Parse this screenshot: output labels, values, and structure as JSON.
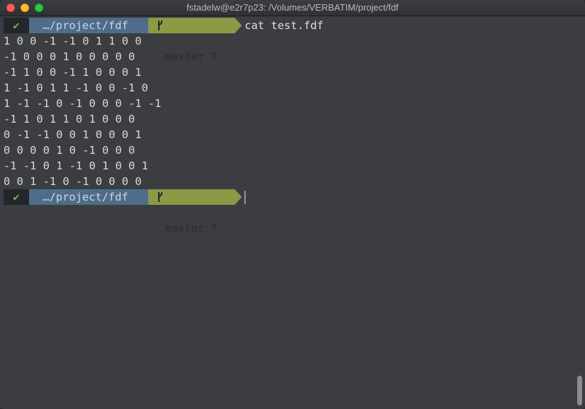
{
  "window": {
    "title": "fstadelw@e2r7p23: /Volumes/VERBATIM/project/fdf"
  },
  "colors": {
    "terminal_bg": "#3b3d41",
    "status_bg": "#23262a",
    "status_fg": "#9aa53b",
    "path_bg": "#4f6d8a",
    "path_fg": "#c8d7e6",
    "git_bg": "#8a9a45",
    "git_fg": "#2a2d26",
    "text": "#d9d9d9"
  },
  "prompt1": {
    "status_icon": "✔",
    "path": " …/project/fdf ",
    "git_icon": "branch-icon",
    "git_branch_symbol": "",
    "git": " master ? ",
    "command": "cat test.fdf"
  },
  "output": [
    "1 0 0 -1 -1 0 1 1 0 0",
    "-1 0 0 0 1 0 0 0 0 0",
    "-1 1 0 0 -1 1 0 0 0 1",
    "1 -1 0 1 1 -1 0 0 -1 0",
    "1 -1 -1 0 -1 0 0 0 -1 -1",
    "-1 1 0 1 1 0 1 0 0 0",
    "0 -1 -1 0 0 1 0 0 0 1",
    "0 0 0 0 1 0 -1 0 0 0",
    "-1 -1 0 1 -1 0 1 0 0 1",
    "0 0 1 -1 0 -1 0 0 0 0"
  ],
  "prompt2": {
    "status_icon": "✔",
    "path": " …/project/fdf ",
    "git_icon": "branch-icon",
    "git_branch_symbol": "",
    "git": " master ? "
  }
}
